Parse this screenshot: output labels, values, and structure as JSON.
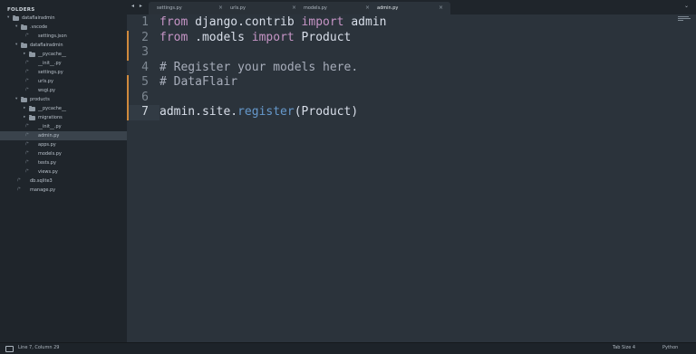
{
  "sidebar": {
    "title": "FOLDERS",
    "items": [
      {
        "label": "dataflairadmin",
        "kind": "folder",
        "depth": 0,
        "expanded": true
      },
      {
        "label": ".vscode",
        "kind": "folder",
        "depth": 1,
        "expanded": true
      },
      {
        "label": "settings.json",
        "kind": "file",
        "depth": 2
      },
      {
        "label": "dataflairadmin",
        "kind": "folder",
        "depth": 1,
        "expanded": true
      },
      {
        "label": "__pycache__",
        "kind": "folder",
        "depth": 2,
        "expanded": false
      },
      {
        "label": "__init__.py",
        "kind": "file",
        "depth": 2
      },
      {
        "label": "settings.py",
        "kind": "file",
        "depth": 2
      },
      {
        "label": "urls.py",
        "kind": "file",
        "depth": 2
      },
      {
        "label": "wsgi.py",
        "kind": "file",
        "depth": 2
      },
      {
        "label": "products",
        "kind": "folder",
        "depth": 1,
        "expanded": true
      },
      {
        "label": "__pycache__",
        "kind": "folder",
        "depth": 2,
        "expanded": false
      },
      {
        "label": "migrations",
        "kind": "folder",
        "depth": 2,
        "expanded": false
      },
      {
        "label": "__init__.py",
        "kind": "file",
        "depth": 2
      },
      {
        "label": "admin.py",
        "kind": "file",
        "depth": 2,
        "selected": true
      },
      {
        "label": "apps.py",
        "kind": "file",
        "depth": 2
      },
      {
        "label": "models.py",
        "kind": "file",
        "depth": 2
      },
      {
        "label": "tests.py",
        "kind": "file",
        "depth": 2
      },
      {
        "label": "views.py",
        "kind": "file",
        "depth": 2
      },
      {
        "label": "db.sqlite3",
        "kind": "file",
        "depth": 1
      },
      {
        "label": "manage.py",
        "kind": "file",
        "depth": 1
      }
    ]
  },
  "tabbar": {
    "nav": "◂ ▸",
    "menu_icon": "chevron-down-icon",
    "tabs": [
      {
        "label": "settings.py",
        "active": false,
        "close": "×"
      },
      {
        "label": "urls.py",
        "active": false,
        "close": "×"
      },
      {
        "label": "models.py",
        "active": false,
        "close": "×"
      },
      {
        "label": "admin.py",
        "active": true,
        "close": "×"
      }
    ]
  },
  "editor": {
    "current_line": 7,
    "lines": [
      {
        "num": "1",
        "modified": false,
        "tokens": [
          {
            "t": "from",
            "c": "kw"
          },
          {
            "t": " django.contrib ",
            "c": "plain"
          },
          {
            "t": "import",
            "c": "kw"
          },
          {
            "t": " admin",
            "c": "plain"
          }
        ]
      },
      {
        "num": "2",
        "modified": true,
        "tokens": [
          {
            "t": "from",
            "c": "kw"
          },
          {
            "t": " .models ",
            "c": "plain"
          },
          {
            "t": "import",
            "c": "kw"
          },
          {
            "t": " Product",
            "c": "plain"
          }
        ]
      },
      {
        "num": "3",
        "modified": true,
        "tokens": []
      },
      {
        "num": "4",
        "modified": false,
        "tokens": [
          {
            "t": "# Register your models here.",
            "c": "cm"
          }
        ]
      },
      {
        "num": "5",
        "modified": true,
        "tokens": [
          {
            "t": "# DataFlair",
            "c": "cm"
          }
        ]
      },
      {
        "num": "6",
        "modified": true,
        "tokens": []
      },
      {
        "num": "7",
        "modified": true,
        "tokens": [
          {
            "t": "admin.site.",
            "c": "plain"
          },
          {
            "t": "register",
            "c": "fn"
          },
          {
            "t": "(Product)",
            "c": "plain"
          }
        ]
      }
    ]
  },
  "statusbar": {
    "position": "Line 7, Column 29",
    "tab_size": "Tab Size 4",
    "syntax": "Python"
  },
  "colors": {
    "modified_marker": "#d08a3c",
    "keyword": "#c594c5",
    "comment": "#a7adba",
    "function": "#6699cc"
  }
}
